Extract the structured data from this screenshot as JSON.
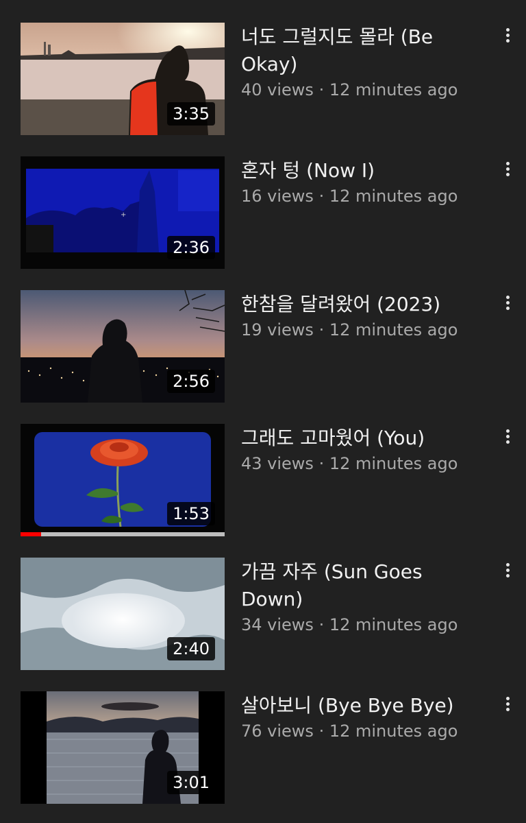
{
  "videos": [
    {
      "title": "너도 그럴지도 몰라 (Be Okay)",
      "views": "40 views",
      "age": "12 minutes ago",
      "duration": "3:35",
      "thumbnail": "person-in-red-jacket-at-river-sunset"
    },
    {
      "title": "혼자 텅 (Now I)",
      "views": "16 views",
      "age": "12 minutes ago",
      "duration": "2:36",
      "thumbnail": "blue-tinted-night-scene"
    },
    {
      "title": "한참을 달려왔어 (2023)",
      "views": "19 views",
      "age": "12 minutes ago",
      "duration": "2:56",
      "thumbnail": "silhouette-over-city-lights-dusk"
    },
    {
      "title": "그래도 고마웠어 (You)",
      "views": "43 views",
      "age": "12 minutes ago",
      "duration": "1:53",
      "thumbnail": "red-rose-on-blue-background",
      "watch_progress": 0.1
    },
    {
      "title": "가끔 자주 (Sun Goes Down)",
      "views": "34 views",
      "age": "12 minutes ago",
      "duration": "2:40",
      "thumbnail": "hazy-cloudy-sky-sun"
    },
    {
      "title": "살아보니 (Bye Bye Bye)",
      "views": "76 views",
      "age": "12 minutes ago",
      "duration": "3:01",
      "thumbnail": "person-by-river-bridge-dusk"
    }
  ],
  "more_icon": "more-vert-icon",
  "colors": {
    "background": "#212121",
    "title": "#f1f1f1",
    "subtitle": "#aaaaaa",
    "progress": "#ff0000"
  }
}
